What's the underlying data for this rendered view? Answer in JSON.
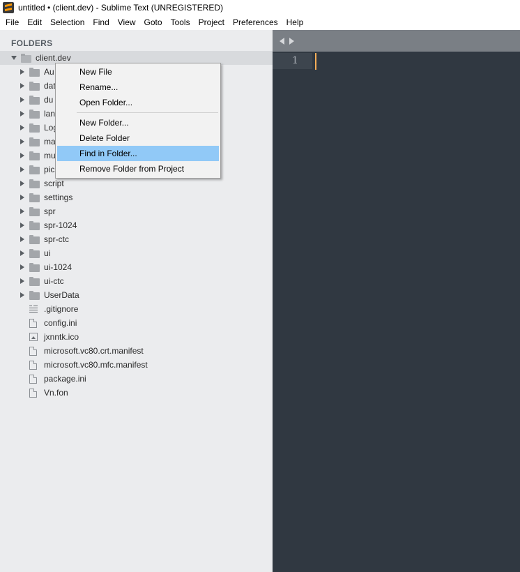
{
  "window": {
    "title": "untitled • (client.dev) - Sublime Text (UNREGISTERED)"
  },
  "menubar": {
    "items": [
      "File",
      "Edit",
      "Selection",
      "Find",
      "View",
      "Goto",
      "Tools",
      "Project",
      "Preferences",
      "Help"
    ]
  },
  "sidebar": {
    "header": "FOLDERS",
    "root": "client.dev",
    "folders": [
      "Au",
      "dat",
      "du",
      "lan",
      "Log",
      "ma",
      "mu",
      "pic",
      "script",
      "settings",
      "spr",
      "spr-1024",
      "spr-ctc",
      "ui",
      "ui-1024",
      "ui-ctc",
      "UserData"
    ],
    "files": [
      {
        "name": ".gitignore",
        "icon": "text-lines-icon"
      },
      {
        "name": "config.ini",
        "icon": "file-icon"
      },
      {
        "name": "jxnntk.ico",
        "icon": "image-icon"
      },
      {
        "name": "microsoft.vc80.crt.manifest",
        "icon": "file-icon"
      },
      {
        "name": "microsoft.vc80.mfc.manifest",
        "icon": "file-icon"
      },
      {
        "name": "package.ini",
        "icon": "file-icon"
      },
      {
        "name": "Vn.fon",
        "icon": "file-icon"
      }
    ]
  },
  "editor": {
    "line_number": "1",
    "caret_color": "#f9ae58",
    "background": "#303841"
  },
  "context_menu": {
    "group1": [
      "New File",
      "Rename...",
      "Open Folder..."
    ],
    "group2": [
      "New Folder...",
      "Delete Folder",
      "Find in Folder...",
      "Remove Folder from Project"
    ],
    "highlighted": "Find in Folder...",
    "highlight_color": "#91c9f7"
  }
}
